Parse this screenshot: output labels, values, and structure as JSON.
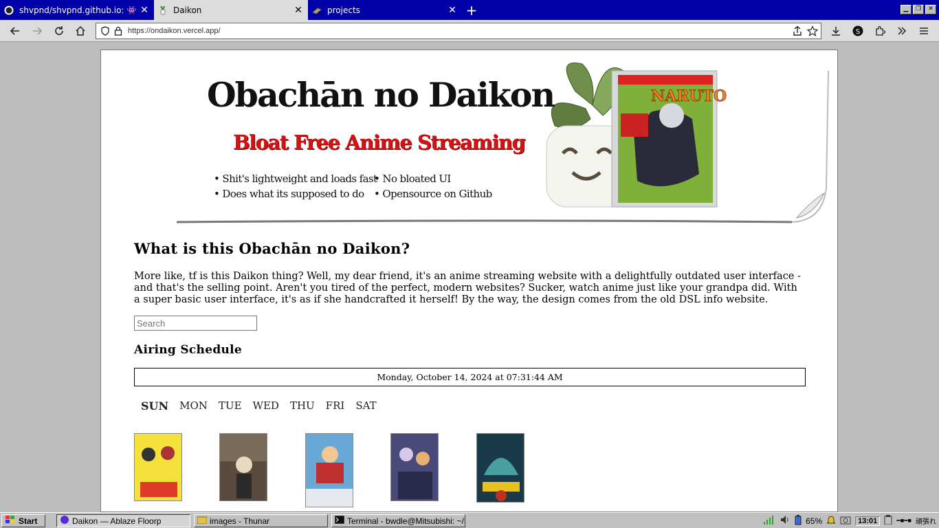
{
  "browser": {
    "tabs": [
      {
        "title": "shvpnd/shvpnd.github.io: 👾 person",
        "icon": "github-icon"
      },
      {
        "title": "Daikon",
        "icon": "daikon-favicon"
      },
      {
        "title": "projects",
        "icon": "projects-favicon"
      }
    ],
    "url": "https://ondaikon.vercel.app/"
  },
  "banner": {
    "title": "Obachān no Daikon",
    "subtitle": "Bloat Free Anime Streaming",
    "bullets_left": [
      "• Shit's lightweight and loads fast",
      "• Does what its supposed to do"
    ],
    "bullets_right": [
      "• No bloated UI",
      "• Opensource on Github"
    ]
  },
  "content": {
    "heading": "What is this Obachān no Daikon?",
    "intro": "More like, tf is this Daikon thing? Well, my dear friend, it's an anime streaming website with a delightfully outdated user interface - and that's the selling point. Aren't you tired of the perfect, modern websites? Sucker, watch anime just like your grandpa did. With a super basic user interface, it's as if she handcrafted it herself! By the way, the design comes from the old DSL info website.",
    "search_placeholder": "Search",
    "schedule_heading": "Airing Schedule",
    "datetime": "Monday, October 14, 2024 at 07:31:44 AM",
    "days": [
      "SUN",
      "MON",
      "TUE",
      "WED",
      "THU",
      "FRI",
      "SAT"
    ],
    "active_day": "SUN"
  },
  "taskbar": {
    "start": "Start",
    "windows": [
      "Daikon — Ablaze Floorp",
      "images - Thunar",
      "Terminal - bwdle@Mitsubishi: ~/P..."
    ],
    "battery": "65%",
    "clock": "13:01",
    "tray_text": "頑張れ"
  },
  "colors": {
    "titlebar": "#0000a8",
    "subtitle_red": "#d41414",
    "desktop_gray": "#c0c0c0"
  }
}
